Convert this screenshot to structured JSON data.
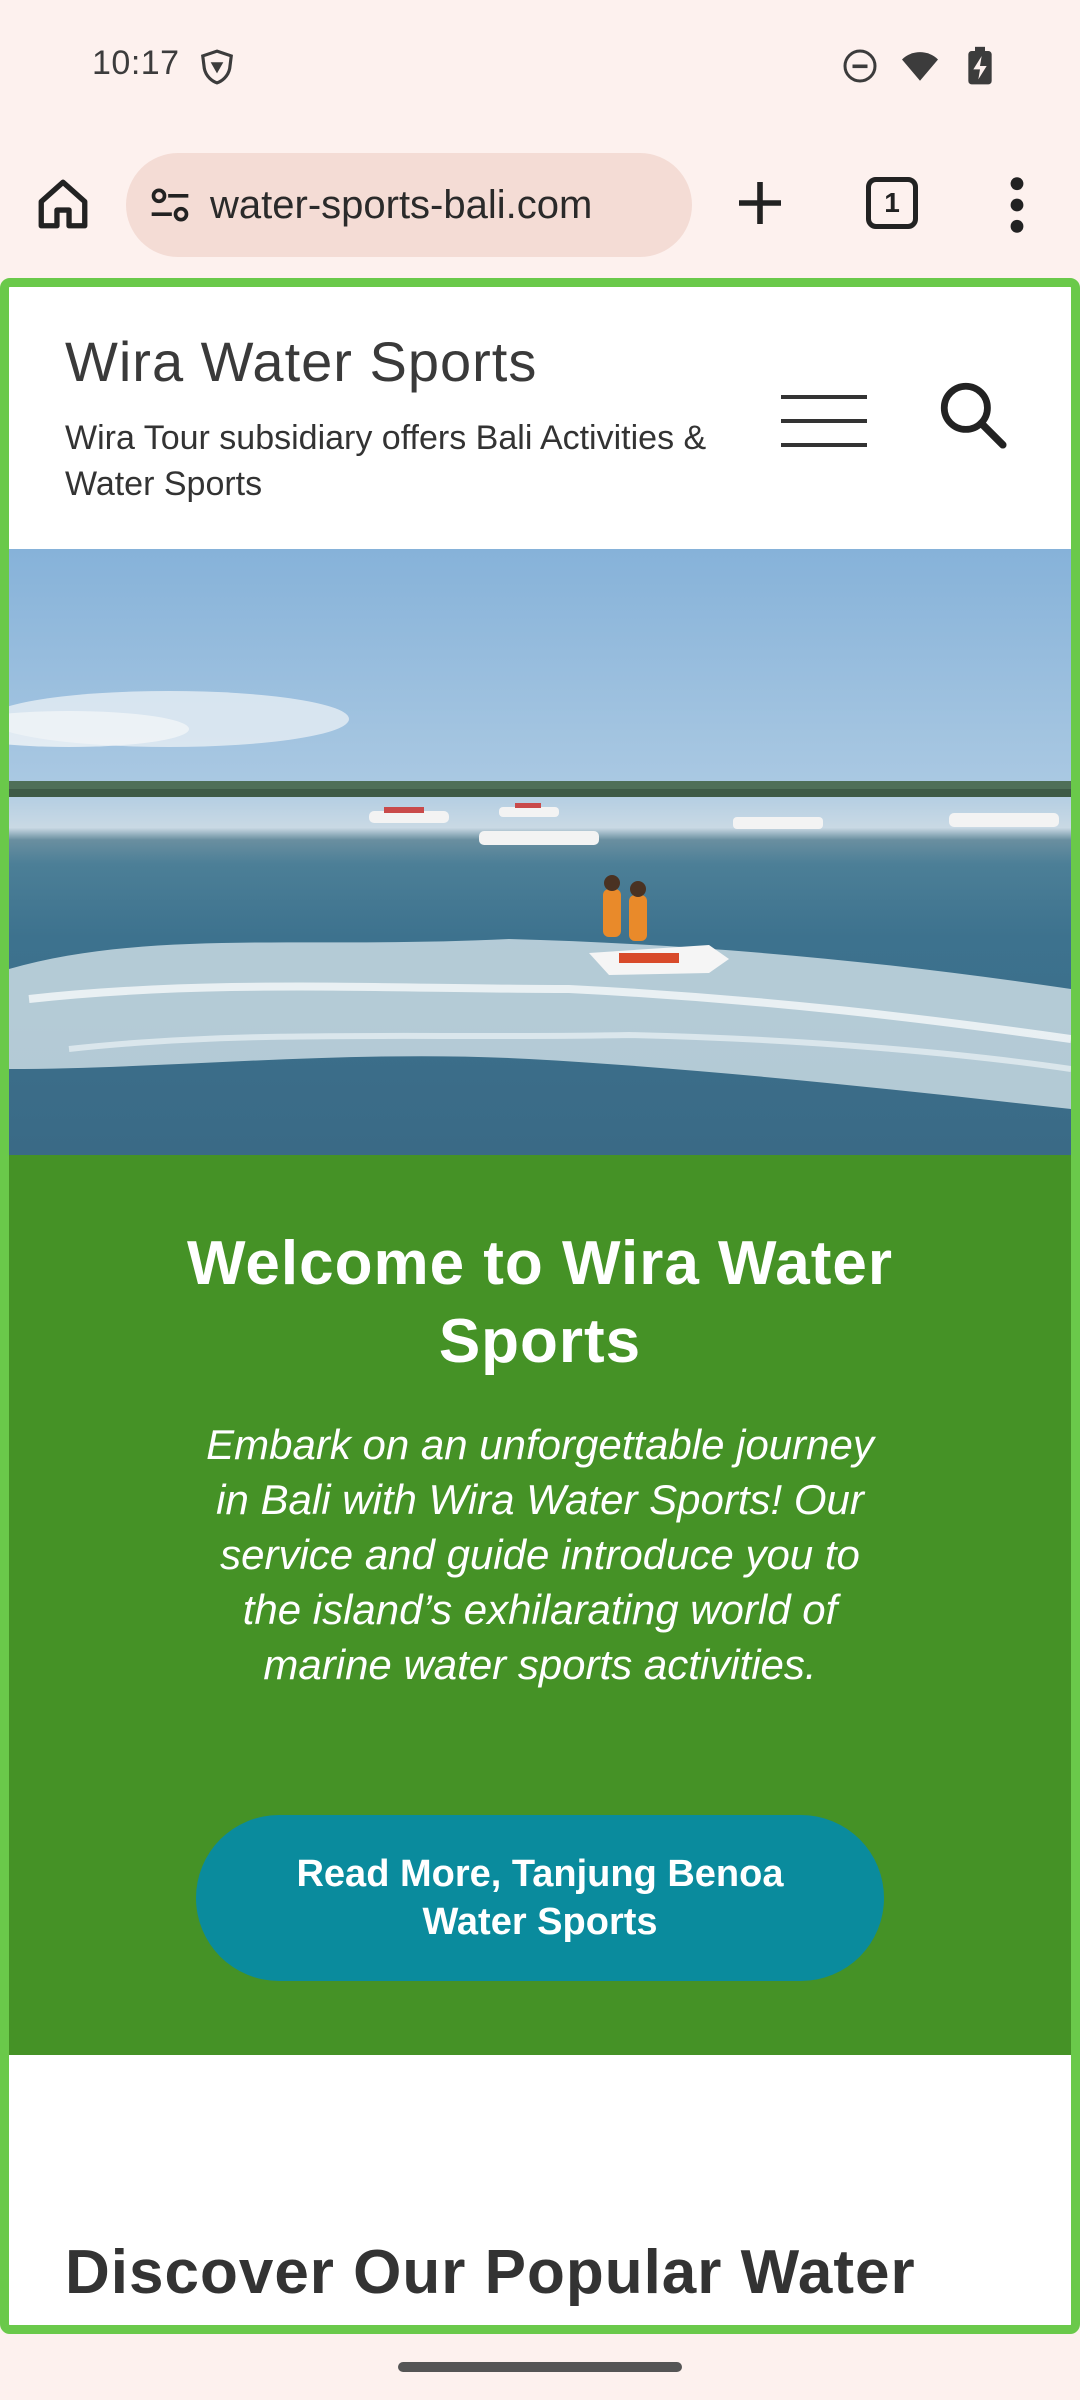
{
  "status_bar": {
    "time": "10:17"
  },
  "browser": {
    "url": "water-sports-bali.com",
    "tab_count": "1"
  },
  "site": {
    "title": "Wira Water Sports",
    "tagline": "Wira Tour subsidiary offers Bali Activities & Water Sports"
  },
  "welcome": {
    "title": "Welcome to Wira Water Sports",
    "text": "Embark on an unforgettable journey in Bali with Wira Water Sports! Our service and guide introduce you to the island’s exhilarating world of marine water sports activities.",
    "cta_label": "Read More, Tanjung Benoa Water Sports"
  },
  "discover": {
    "title": "Discover Our Popular Water Sports Deals"
  },
  "colors": {
    "welcome_bg": "#459226",
    "cta_bg": "#0a8b9d",
    "frame_border": "#6ac94a",
    "chrome_bg": "#fdf1ee"
  }
}
